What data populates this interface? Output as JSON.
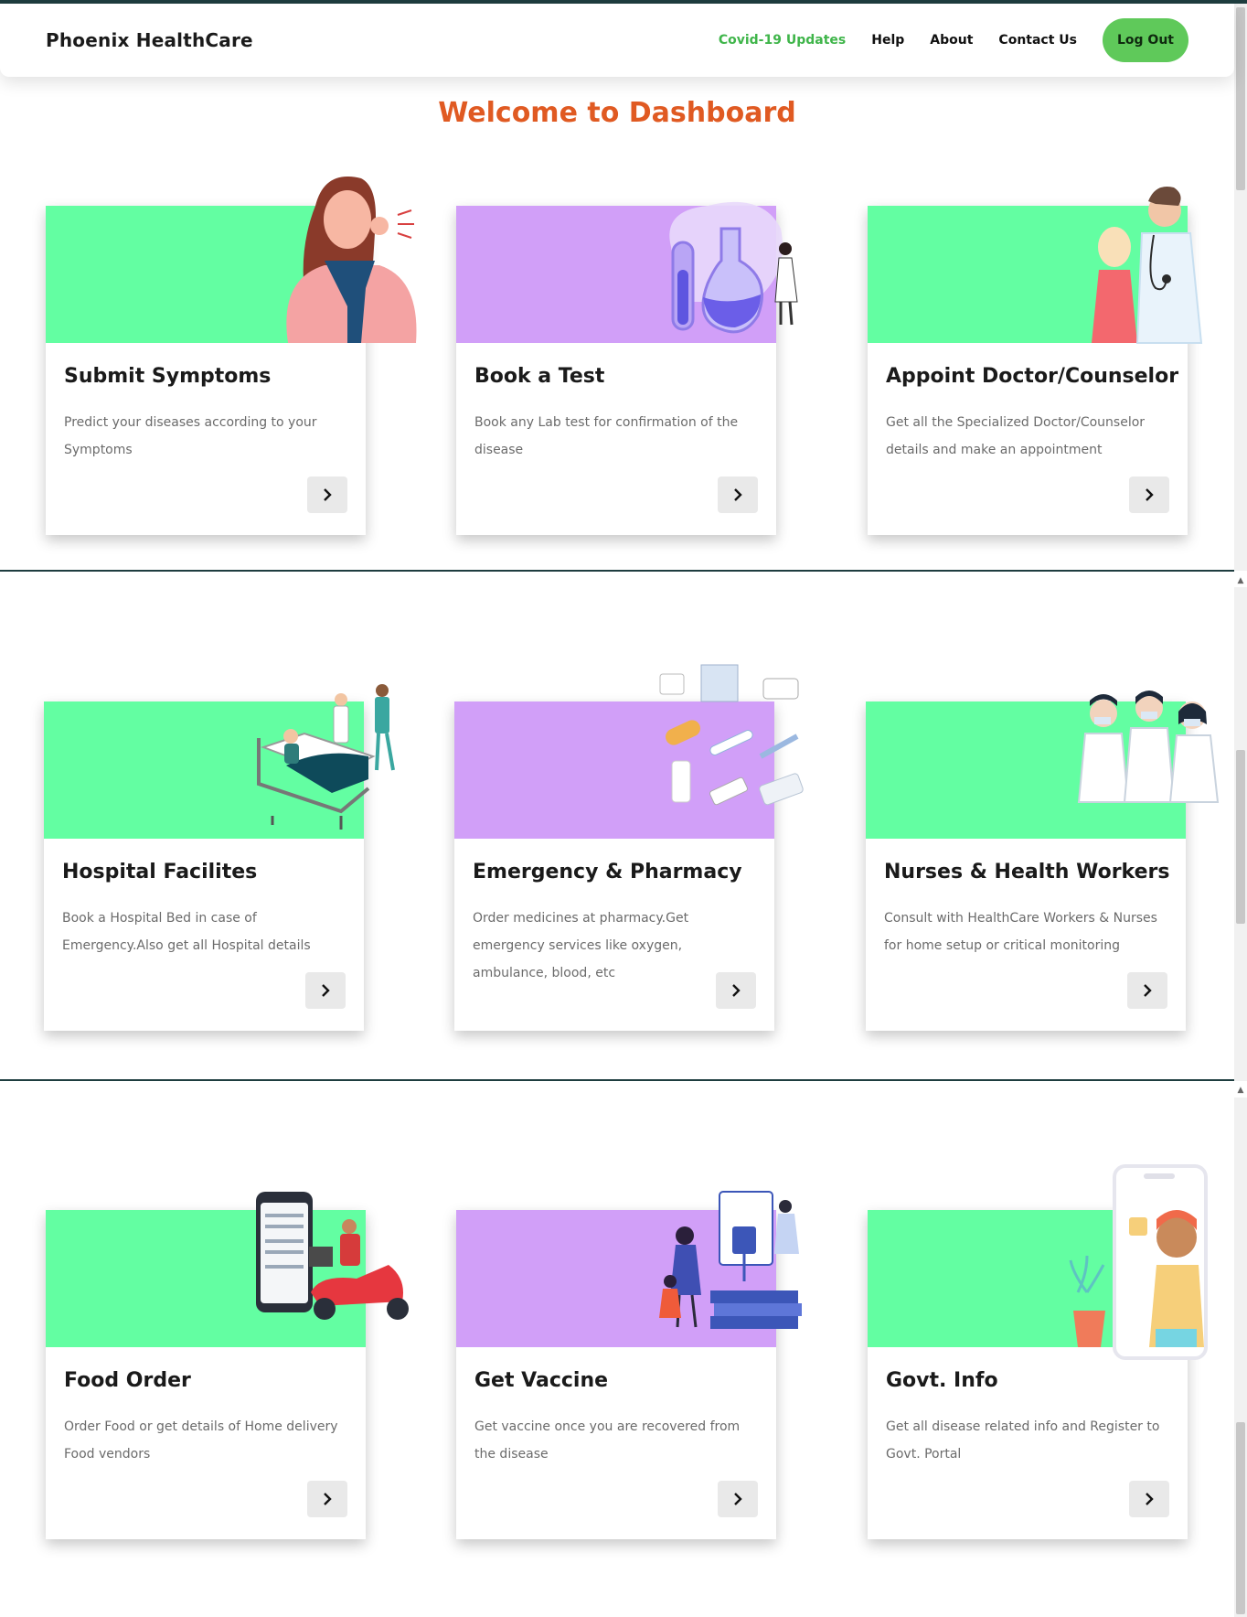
{
  "nav": {
    "brand": "Phoenix HealthCare",
    "links": [
      "Covid-19 Updates",
      "Help",
      "About",
      "Contact Us"
    ],
    "logout": "Log Out"
  },
  "welcome": "Welcome to Dashboard",
  "colors": {
    "green_panel": "#63fea2",
    "purple_panel": "#d19ff8",
    "accent_green": "#5fc95a",
    "title_orange": "#e05a22"
  },
  "cards": [
    {
      "title": "Submit Symptoms",
      "desc": "Predict your diseases according to your Symptoms",
      "icon": "chevron-right-icon"
    },
    {
      "title": "Book a Test",
      "desc": "Book any Lab test for confirmation of the disease",
      "icon": "chevron-right-icon"
    },
    {
      "title": "Appoint Doctor/Counselor",
      "desc": "Get all the Specialized Doctor/Counselor details and make an appointment",
      "icon": "chevron-right-icon"
    },
    {
      "title": "Hospital Facilites",
      "desc": "Book a Hospital Bed in case of Emergency.Also get all Hospital details",
      "icon": "chevron-right-icon"
    },
    {
      "title": "Emergency & Pharmacy",
      "desc": "Order medicines at pharmacy.Get emergency services like oxygen, ambulance, blood, etc",
      "icon": "chevron-right-icon"
    },
    {
      "title": "Nurses & Health Workers",
      "desc": "Consult with HealthCare Workers & Nurses for home setup or critical monitoring",
      "icon": "chevron-right-icon"
    },
    {
      "title": "Food Order",
      "desc": "Order Food or get details of Home delivery Food vendors",
      "icon": "chevron-right-icon"
    },
    {
      "title": "Get Vaccine",
      "desc": "Get vaccine once you are recovered from the disease",
      "icon": "chevron-right-icon"
    },
    {
      "title": "Govt. Info",
      "desc": "Get all disease related info and Register to Govt. Portal",
      "icon": "chevron-right-icon"
    }
  ]
}
